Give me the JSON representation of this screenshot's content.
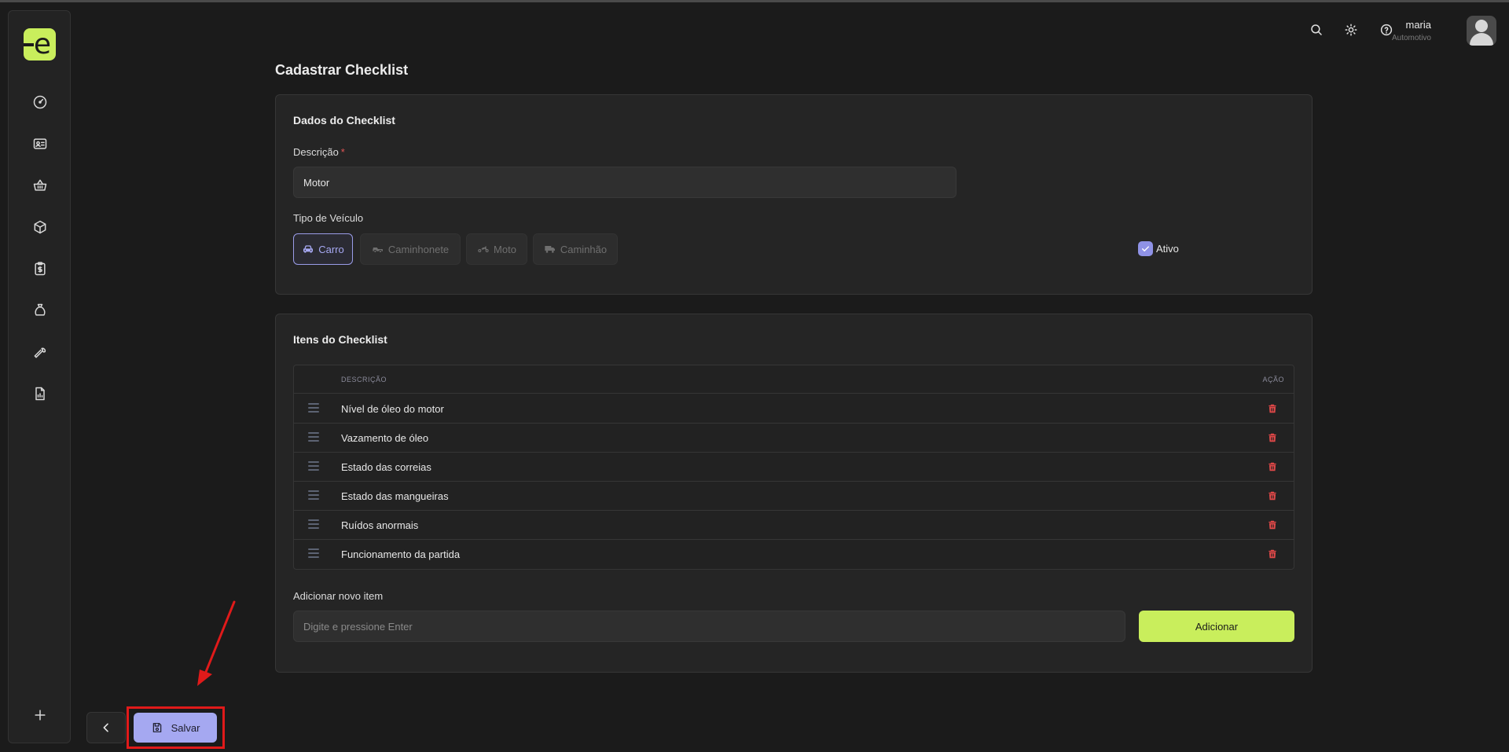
{
  "colors": {
    "background": "#1b1b1b",
    "card": "#252525",
    "accent_lime": "#c9ee5c",
    "accent_purple": "#a5a8f1",
    "danger": "#e04848",
    "annotation_red": "#e01a1a"
  },
  "logo": {
    "letter": "e",
    "icon": "brand-logo"
  },
  "sidebar": {
    "items": [
      {
        "icon": "dashboard-gauge-icon"
      },
      {
        "icon": "id-card-icon"
      },
      {
        "icon": "shopping-basket-icon"
      },
      {
        "icon": "box-icon"
      },
      {
        "icon": "clipboard-dollar-icon"
      },
      {
        "icon": "money-bag-icon"
      },
      {
        "icon": "wrench-icon"
      },
      {
        "icon": "report-chart-icon"
      }
    ],
    "add_icon": "plus-icon"
  },
  "header": {
    "icons": [
      "search-icon",
      "sun-icon",
      "help-icon"
    ],
    "user_name": "maria",
    "user_role": "Automotivo"
  },
  "page": {
    "title": "Cadastrar Checklist"
  },
  "dados": {
    "title": "Dados do Checklist",
    "descricao_label": "Descrição",
    "required_mark": "*",
    "descricao_value": "Motor",
    "tipo_label": "Tipo de Veículo",
    "vehicle_types": [
      {
        "label": "Carro",
        "icon": "car-icon",
        "selected": true
      },
      {
        "label": "Caminhonete",
        "icon": "pickup-truck-icon",
        "selected": false
      },
      {
        "label": "Moto",
        "icon": "motorcycle-icon",
        "selected": false
      },
      {
        "label": "Caminhão",
        "icon": "truck-icon",
        "selected": false
      }
    ],
    "ativo_label": "Ativo",
    "ativo_checked": true
  },
  "itens": {
    "title": "Itens do Checklist",
    "columns": {
      "descricao": "DESCRIÇÃO",
      "acao": "AÇÃO"
    },
    "rows": [
      {
        "descricao": "Nível de óleo do motor"
      },
      {
        "descricao": "Vazamento de óleo"
      },
      {
        "descricao": "Estado das correias"
      },
      {
        "descricao": "Estado das mangueiras"
      },
      {
        "descricao": "Ruídos anormais"
      },
      {
        "descricao": "Funcionamento da partida"
      }
    ],
    "add_label": "Adicionar novo item",
    "add_placeholder": "Digite e pressione Enter",
    "add_button": "Adicionar"
  },
  "footer": {
    "back_icon": "chevron-left-icon",
    "save_label": "Salvar",
    "save_icon": "floppy-disk-icon"
  }
}
